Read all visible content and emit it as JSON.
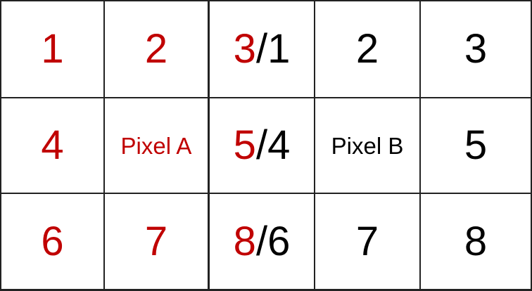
{
  "colors": {
    "neighbors_a": "#c00000",
    "neighbors_b": "#000000",
    "grid_line": "#222222"
  },
  "rows": [
    [
      {
        "a": "1",
        "b": ""
      },
      {
        "a": "2",
        "b": ""
      },
      {
        "a": "3",
        "sep": "/",
        "b": "1"
      },
      {
        "a": "",
        "b": "2"
      },
      {
        "a": "",
        "b": "3"
      }
    ],
    [
      {
        "a": "4",
        "b": ""
      },
      {
        "a": "Pixel A",
        "b": "",
        "label": true
      },
      {
        "a": "5",
        "sep": "/",
        "b": "4"
      },
      {
        "a": "",
        "b": "Pixel B",
        "label": true
      },
      {
        "a": "",
        "b": "5"
      }
    ],
    [
      {
        "a": "6",
        "b": ""
      },
      {
        "a": "7",
        "b": ""
      },
      {
        "a": "8",
        "sep": "/",
        "b": "6"
      },
      {
        "a": "",
        "b": "7"
      },
      {
        "a": "",
        "b": "8"
      }
    ]
  ]
}
